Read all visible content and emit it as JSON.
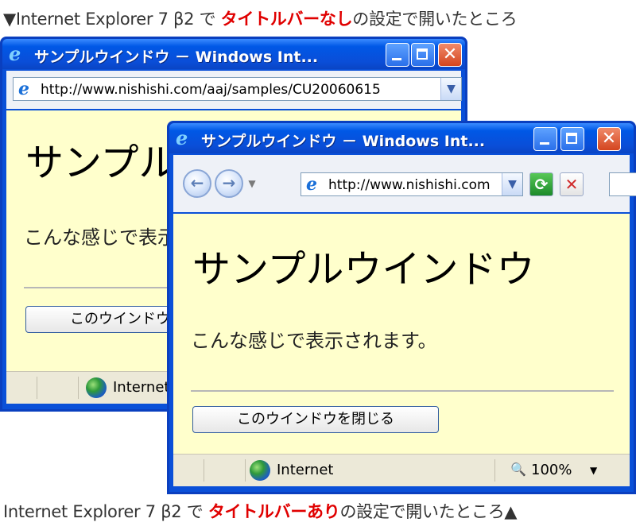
{
  "captions": {
    "top_prefix": "▼Internet Explorer 7 β2 で ",
    "top_highlight": "タイトルバーなし",
    "top_suffix": "の設定で開いたところ",
    "bottom_prefix": "Internet Explorer 7 β2 で ",
    "bottom_highlight": "タイトルバーあり",
    "bottom_suffix": "の設定で開いたところ▲"
  },
  "window_back": {
    "title": "サンプルウインドウ － Windows Int...",
    "address": "http://www.nishishi.com/aaj/samples/CU20060615",
    "heading": "サンプルウインドウ",
    "body_text": "こんな感じで表示されます。",
    "close_button": "このウインドウを閉じる",
    "status_zone": "Internet"
  },
  "window_front": {
    "title": "サンプルウインドウ － Windows Int...",
    "address": "http://www.nishishi.com",
    "heading": "サンプルウインドウ",
    "body_text": "こんな感じで表示されます。",
    "close_button": "このウインドウを閉じる",
    "status_zone": "Internet",
    "zoom": "100%"
  },
  "icons": {
    "ie": "ie-logo-icon",
    "minimize": "minimize-icon",
    "maximize": "maximize-icon",
    "close": "close-icon",
    "back": "back-arrow-icon",
    "forward": "forward-arrow-icon",
    "refresh": "refresh-icon",
    "stop": "stop-icon",
    "globe": "internet-globe-icon",
    "zoom": "zoom-magnifier-icon"
  },
  "colors": {
    "titlebar": "#0a50d8",
    "content_bg": "#ffffcc",
    "caption_highlight": "#e00000"
  }
}
